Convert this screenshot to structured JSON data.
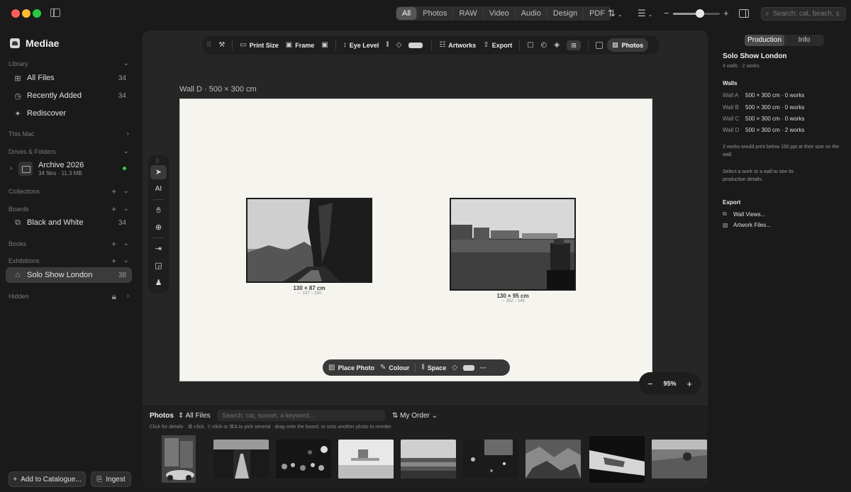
{
  "toolbar_top": {
    "segments": [
      "All",
      "Photos",
      "RAW",
      "Video",
      "Audio",
      "Design",
      "PDF"
    ],
    "active_segment": "All",
    "search_placeholder": "Search: cat, beach, s",
    "zoom_minus": "−",
    "zoom_plus": "+"
  },
  "sidebar": {
    "app_name": "Mediae",
    "library": {
      "header": "Library",
      "items": [
        {
          "label": "All Files",
          "count": "34",
          "icon": "grid-icon"
        },
        {
          "label": "Recently Added",
          "count": "34",
          "icon": "clock-icon"
        },
        {
          "label": "Rediscover",
          "count": "",
          "icon": "sparkle-icon"
        }
      ]
    },
    "this_mac": "This Mac",
    "drives_header": "Drives & Folders",
    "archive": {
      "name": "Archive 2026",
      "meta": "34 files · 11.3 MB",
      "status_color": "#2fce4e"
    },
    "collections_header": "Collections",
    "boards_header": "Boards",
    "boards": [
      {
        "label": "Black and White",
        "count": "34"
      }
    ],
    "books_header": "Books",
    "exhibitions_header": "Exhibitions",
    "exhibitions": [
      {
        "label": "Solo Show London",
        "count": "38"
      }
    ],
    "hidden_header": "Hidden",
    "add_button": "Add to Catalogue...",
    "ingest_button": "Ingest"
  },
  "canvas_toolbar": {
    "print_size": "Print Size",
    "frame": "Frame",
    "eye_level": "Eye Level",
    "artworks": "Artworks",
    "export": "Export",
    "photos": "Photos"
  },
  "wall": {
    "caption": "Wall D  ·  500 × 300 cm",
    "background_color": "#f5f4ef",
    "artworks": [
      {
        "size": "130 × 87 cm",
        "pixels": "⇔ 137  ↕ 150"
      },
      {
        "size": "130 × 95 cm",
        "pixels": "⇔ 352  ↕ 146"
      }
    ]
  },
  "bottom_toolbar": {
    "place_photo": "Place Photo",
    "colour": "Colour",
    "space": "Space",
    "more": "···"
  },
  "zoom": {
    "value": "95%",
    "minus": "−",
    "plus": "+"
  },
  "photos_strip": {
    "title": "Photos",
    "filter": "All Files",
    "search_placeholder": "Search: cat, sunset, a keyword...",
    "order": "My Order",
    "hint": "Click for details · ⌘-click, ⇧-click or ⌘A to pick several · drag onto the board, or onto another photo to reorder",
    "thumbnail_count": 9
  },
  "inspector": {
    "tabs": [
      "Production",
      "Info"
    ],
    "active_tab": "Production",
    "title": "Solo Show London",
    "subtitle": "4 walls · 2 works",
    "walls_header": "Walls",
    "walls": [
      {
        "name": "Wall A",
        "detail": "500 × 300 cm · 0 works"
      },
      {
        "name": "Wall B",
        "detail": "500 × 300 cm · 0 works"
      },
      {
        "name": "Wall C",
        "detail": "500 × 300 cm · 0 works"
      },
      {
        "name": "Wall D",
        "detail": "500 × 300 cm · 2 works"
      }
    ],
    "warning": "2 works would print below 150 ppi at their size on the wall.",
    "hint": "Select a work or a wall to see its production details.",
    "export_header": "Export",
    "exports": [
      "Wall Views...",
      "Artwork Files..."
    ]
  }
}
